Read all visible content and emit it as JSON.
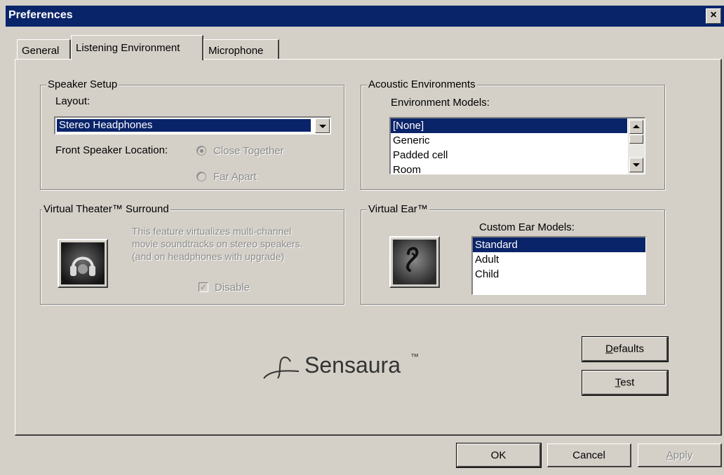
{
  "window": {
    "title": "Preferences",
    "close_label": "×"
  },
  "tabs": [
    {
      "label": "General"
    },
    {
      "label": "Listening Environment"
    },
    {
      "label": "Microphone"
    }
  ],
  "speaker_setup": {
    "title": "Speaker Setup",
    "layout_label": "Layout:",
    "layout_value": "Stereo Headphones",
    "front_label": "Front Speaker Location:",
    "option_close": "Close Together",
    "option_far": "Far Apart"
  },
  "acoustic": {
    "title": "Acoustic Environments",
    "models_label": "Environment Models:",
    "items": [
      "[None]",
      "Generic",
      "Padded cell",
      "Room"
    ]
  },
  "virtual_theater": {
    "title": "Virtual Theater™ Surround",
    "desc_1": "This  feature  virtualizes multi-channel",
    "desc_2": "movie soundtracks on stereo speakers.",
    "desc_3": "(and on headphones with upgrade)",
    "disable_label": "Disable",
    "disable_checked": true
  },
  "virtual_ear": {
    "title": "Virtual Ear™",
    "models_label": "Custom Ear Models:",
    "items": [
      "Standard",
      "Adult",
      "Child"
    ]
  },
  "logo": {
    "text": "Sensaura",
    "tm": "™"
  },
  "buttons": {
    "defaults_d": "D",
    "defaults_rest": "efaults",
    "test_t": "T",
    "test_rest": "est",
    "ok": "OK",
    "cancel": "Cancel",
    "apply_a": "A",
    "apply_rest": "pply"
  },
  "colors": {
    "selection": "#0a246a",
    "face": "#d4d0c8",
    "disabled_text": "#8a8a8a"
  },
  "icons": {
    "theater": "headphones-icon",
    "ear": "ear-icon",
    "logo": "sensaura-logo-icon"
  }
}
